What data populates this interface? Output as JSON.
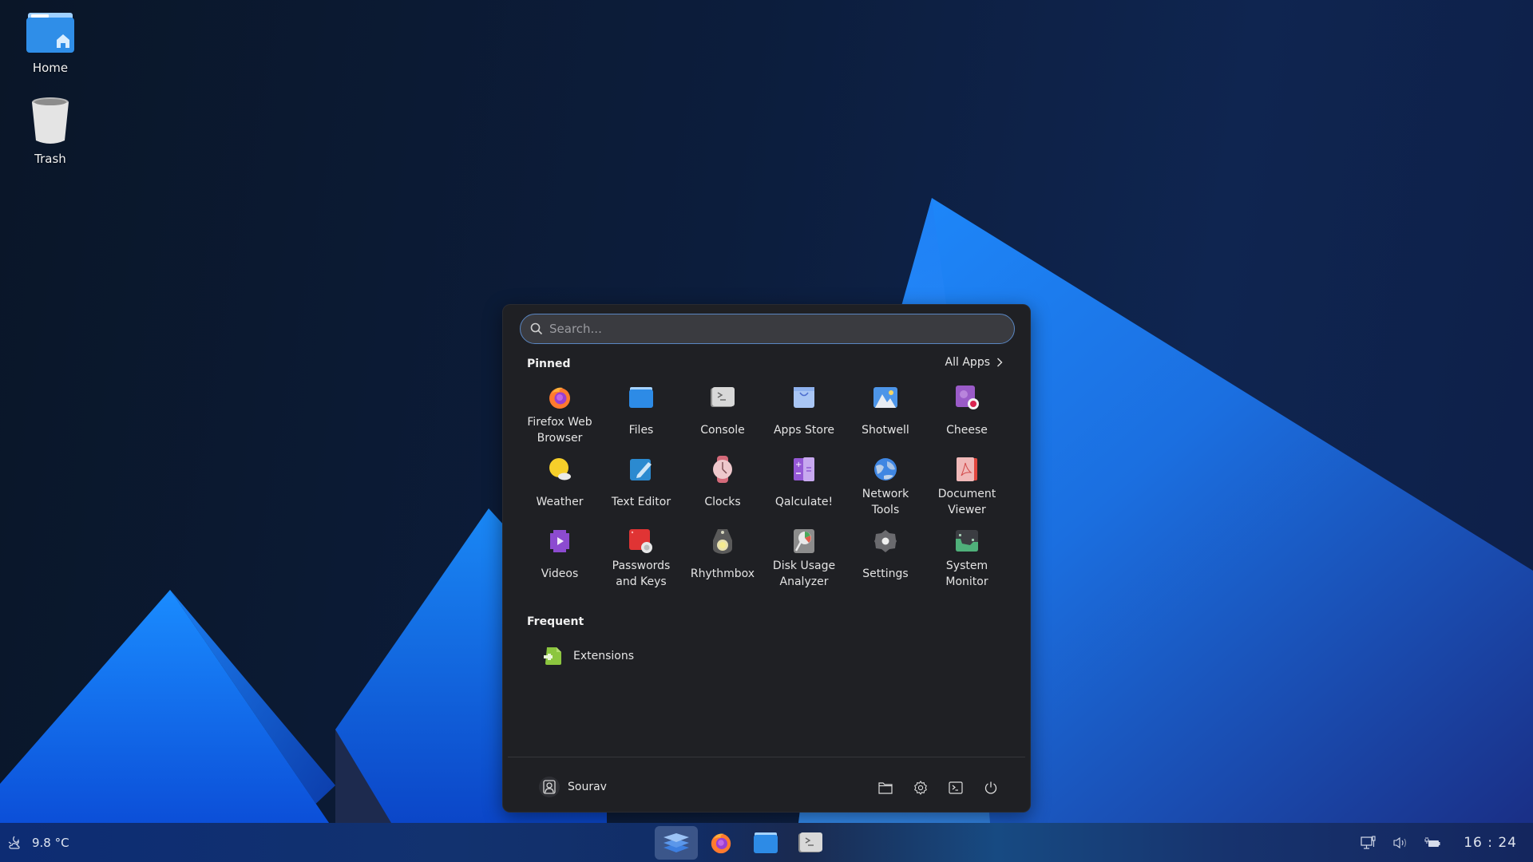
{
  "desktop": {
    "icons": [
      {
        "label": "Home",
        "icon": "home-folder-icon"
      },
      {
        "label": "Trash",
        "icon": "trash-icon"
      }
    ]
  },
  "menu": {
    "search": {
      "placeholder": "Search...",
      "value": ""
    },
    "pinned_title": "Pinned",
    "all_apps_label": "All Apps",
    "pinned": [
      {
        "label": "Firefox Web\nBrowser",
        "icon": "firefox-icon"
      },
      {
        "label": "Files",
        "icon": "files-icon"
      },
      {
        "label": "Console",
        "icon": "console-icon"
      },
      {
        "label": "Apps Store",
        "icon": "apps-store-icon"
      },
      {
        "label": "Shotwell",
        "icon": "shotwell-icon"
      },
      {
        "label": "Cheese",
        "icon": "cheese-icon"
      },
      {
        "label": "Weather",
        "icon": "weather-icon"
      },
      {
        "label": "Text Editor",
        "icon": "text-editor-icon"
      },
      {
        "label": "Clocks",
        "icon": "clocks-icon"
      },
      {
        "label": "Qalculate!",
        "icon": "calculator-icon"
      },
      {
        "label": "Network\nTools",
        "icon": "network-tools-icon"
      },
      {
        "label": "Document\nViewer",
        "icon": "document-viewer-icon"
      },
      {
        "label": "Videos",
        "icon": "videos-icon"
      },
      {
        "label": "Passwords\nand Keys",
        "icon": "passwords-icon"
      },
      {
        "label": "Rhythmbox",
        "icon": "rhythmbox-icon"
      },
      {
        "label": "Disk Usage\nAnalyzer",
        "icon": "disk-usage-icon"
      },
      {
        "label": "Settings",
        "icon": "settings-icon"
      },
      {
        "label": "System\nMonitor",
        "icon": "system-monitor-icon"
      }
    ],
    "frequent_title": "Frequent",
    "frequent": [
      {
        "label": "Extensions",
        "icon": "extensions-icon"
      }
    ],
    "footer": {
      "user_name": "Sourav",
      "buttons": [
        "folder-icon",
        "gear-icon",
        "terminal-icon",
        "power-icon"
      ]
    }
  },
  "taskbar": {
    "weather": {
      "temperature": "9.8 °C",
      "icon": "night-cloud-icon"
    },
    "dock": [
      "launcher",
      "firefox",
      "files",
      "console"
    ],
    "tray": [
      "network-wired-icon",
      "volume-icon",
      "battery-charging-icon"
    ],
    "clock": "16 : 24"
  },
  "colors": {
    "panel_bg": "#1f2024",
    "search_border": "#5a86c2",
    "accent_blue": "#2b8af0"
  }
}
